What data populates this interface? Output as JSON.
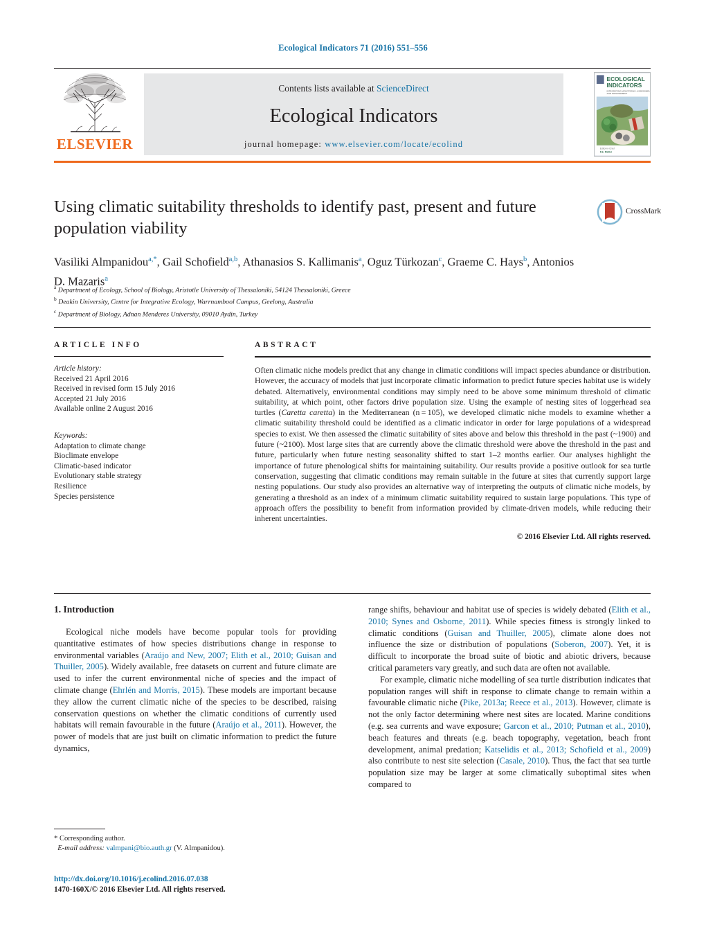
{
  "running_head": "Ecological Indicators 71 (2016) 551–556",
  "masthead": {
    "contents_prefix": "Contents lists available at ",
    "sciencedirect": "ScienceDirect",
    "journal_name": "Ecological Indicators",
    "homepage_prefix": "journal homepage: ",
    "homepage_url": "www.elsevier.com/locate/ecolind",
    "publisher": "ELSEVIER",
    "cover_title_line1": "ECOLOGICAL",
    "cover_title_line2": "INDICATORS",
    "accent_orange": "#ef6a1e",
    "link_blue": "#1673a6"
  },
  "title": "Using climatic suitability thresholds to identify past, present and future population viability",
  "crossmark_label": "CrossMark",
  "authors_html": "Vasiliki Almpanidou<sup>a,*</sup>, Gail Schofield<sup>a,b</sup>, Athanasios S. Kallimanis<sup>a</sup>, Oguz Türkozan<sup>c</sup>, Graeme C. Hays<sup>b</sup>, Antonios D. Mazaris<sup>a</sup>",
  "affiliations": [
    {
      "marker": "a",
      "text": "Department of Ecology, School of Biology, Aristotle University of Thessaloniki, 54124 Thessaloniki, Greece"
    },
    {
      "marker": "b",
      "text": "Deakin University, Centre for Integrative Ecology, Warrnambool Campus, Geelong, Australia"
    },
    {
      "marker": "c",
      "text": "Department of Biology, Adnan Menderes University, 09010 Aydin, Turkey"
    }
  ],
  "article_info": {
    "heading": "ARTICLE INFO",
    "history_label": "Article history:",
    "history": [
      "Received 21 April 2016",
      "Received in revised form 15 July 2016",
      "Accepted 21 July 2016",
      "Available online 2 August 2016"
    ],
    "keywords_label": "Keywords:",
    "keywords": [
      "Adaptation to climate change",
      "Bioclimate envelope",
      "Climatic-based indicator",
      "Evolutionary stable strategy",
      "Resilience",
      "Species persistence"
    ]
  },
  "abstract": {
    "heading": "ABSTRACT",
    "text_html": "Often climatic niche models predict that any change in climatic conditions will impact species abundance or distribution. However, the accuracy of models that just incorporate climatic information to predict future species habitat use is widely debated. Alternatively, environmental conditions may simply need to be above some minimum threshold of climatic suitability, at which point, other factors drive population size. Using the example of nesting sites of loggerhead sea turtles (<i>Caretta caretta</i>) in the Mediterranean (n&#8201;=&#8201;105), we developed climatic niche models to examine whether a climatic suitability threshold could be identified as a climatic indicator in order for large populations of a widespread species to exist. We then assessed the climatic suitability of sites above and below this threshold in the past (~1900) and future (~2100). Most large sites that are currently above the climatic threshold were above the threshold in the past and future, particularly when future nesting seasonality shifted to start 1&#8211;2 months earlier. Our analyses highlight the importance of future phenological shifts for maintaining suitability. Our results provide a positive outlook for sea turtle conservation, suggesting that climatic conditions may remain suitable in the future at sites that currently support large nesting populations. Our study also provides an alternative way of interpreting the outputs of climatic niche models, by generating a threshold as an index of a minimum climatic suitability required to sustain large populations. This type of approach offers the possibility to benefit from information provided by climate-driven models, while reducing their inherent uncertainties.",
    "copyright": "© 2016 Elsevier Ltd. All rights reserved."
  },
  "introduction": {
    "section_title": "1. Introduction",
    "left_paragraph_html": "Ecological niche models have become popular tools for providing quantitative estimates of how species distributions change in response to environmental variables (<span class=\"ref\">Araújo and New, 2007; Elith et al., 2010; Guisan and Thuiller, 2005</span>). Widely available, free datasets on current and future climate are used to infer the current environmental niche of species and the impact of climate change (<span class=\"ref\">Ehrlén and Morris, 2015</span>). These models are important because they allow the current climatic niche of the species to be described, raising conservation questions on whether the climatic conditions of currently used habitats will remain favourable in the future (<span class=\"ref\">Araújo et al., 2011</span>). However, the power of models that are just built on climatic information to predict the future dynamics,",
    "right_paragraph1_html": "range shifts, behaviour and habitat use of species is widely debated (<span class=\"ref\">Elith et al., 2010; Synes and Osborne, 2011</span>). While species fitness is strongly linked to climatic conditions (<span class=\"ref\">Guisan and Thuiller, 2005</span>), climate alone does not influence the size or distribution of populations (<span class=\"ref\">Soberon, 2007</span>). Yet, it is difficult to incorporate the broad suite of biotic and abiotic drivers, because critical parameters vary greatly, and such data are often not available.",
    "right_paragraph2_html": "For example, climatic niche modelling of sea turtle distribution indicates that population ranges will shift in response to climate change to remain within a favourable climatic niche (<span class=\"ref\">Pike, 2013a; Reece et al., 2013</span>). However, climate is not the only factor determining where nest sites are located. Marine conditions (e.g. sea currents and wave exposure; <span class=\"ref\">Garcon et al., 2010; Putman et al., 2010</span>), beach features and threats (e.g. beach topography, vegetation, beach front development, animal predation; <span class=\"ref\">Katselidis et al., 2013; Schofield et al., 2009</span>) also contribute to nest site selection (<span class=\"ref\">Casale, 2010</span>). Thus, the fact that sea turtle population size may be larger at some climatically suboptimal sites when compared to"
  },
  "footnote": {
    "corresponding_author": "* Corresponding author.",
    "email_label": "E-mail address:",
    "email": "valmpani@bio.auth.gr",
    "email_owner": "(V. Almpanidou)."
  },
  "footer": {
    "doi": "http://dx.doi.org/10.1016/j.ecolind.2016.07.038",
    "issn_line": "1470-160X/© 2016 Elsevier Ltd. All rights reserved."
  }
}
